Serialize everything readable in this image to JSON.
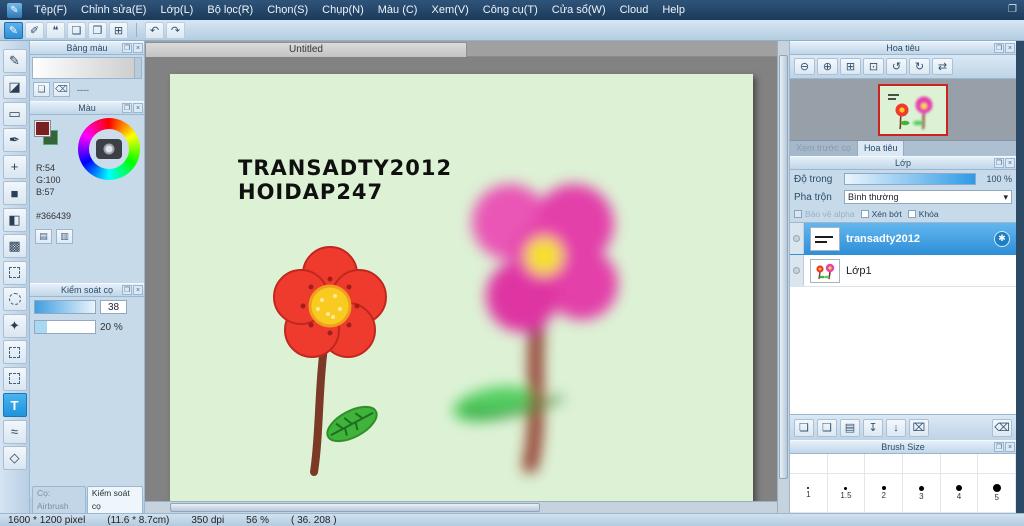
{
  "icons": {
    "app": "✎",
    "window": "❐",
    "dock": "❐",
    "close": "×",
    "undo": "↶",
    "redo": "↷",
    "zoom_out": "⊖",
    "zoom_in": "⊕",
    "fit_window": "⊞",
    "zoom_actual": "⊡",
    "rotate_ccw": "↺",
    "rotate_cw": "↻",
    "flip": "⇄",
    "new_layer": "❏",
    "new_linework_layer": "❑",
    "new_folder": "▤",
    "transfer_down": "↧",
    "merge_down": "↓",
    "clear_layer": "⌧",
    "delete_layer": "⌫",
    "gear": "✱",
    "palette_new": "❏",
    "palette_delete": "⌫",
    "swatch_grid1": "▤",
    "swatch_grid2": "▥",
    "dropdown_arrow": "▾"
  },
  "menubar": {
    "items": [
      "Tệp(F)",
      "Chỉnh sửa(E)",
      "Lớp(L)",
      "Bộ lọc(R)",
      "Chọn(S)",
      "Chụp(N)",
      "Màu (C)",
      "Xem(V)",
      "Công cụ(T)",
      "Cửa sổ(W)",
      "Cloud",
      "Help"
    ]
  },
  "toolbar": {
    "items": [
      {
        "name": "brush",
        "glyph": "✎"
      },
      {
        "name": "pin",
        "glyph": "✐"
      },
      {
        "name": "note",
        "glyph": "❝"
      },
      {
        "name": "doc1",
        "glyph": "❏"
      },
      {
        "name": "doc2",
        "glyph": "❐"
      },
      {
        "name": "grid",
        "glyph": "⊞"
      }
    ]
  },
  "tools": [
    {
      "name": "pencil",
      "glyph": "✎"
    },
    {
      "name": "eraser",
      "glyph": "◪"
    },
    {
      "name": "rect",
      "glyph": "▭"
    },
    {
      "name": "pen",
      "glyph": "✒"
    },
    {
      "name": "move",
      "glyph": "+"
    },
    {
      "name": "shape",
      "glyph": "■"
    },
    {
      "name": "bucket",
      "glyph": "◧"
    },
    {
      "name": "gradient",
      "glyph": "▩"
    },
    {
      "name": "select-rect",
      "glyph": ""
    },
    {
      "name": "lasso",
      "glyph": ""
    },
    {
      "name": "magic-wand",
      "glyph": "✦"
    },
    {
      "name": "select-pen",
      "glyph": ""
    },
    {
      "name": "select-eraser",
      "glyph": ""
    },
    {
      "name": "text",
      "glyph": "T"
    },
    {
      "name": "curve",
      "glyph": "≈"
    },
    {
      "name": "polygon",
      "glyph": "◇"
    }
  ],
  "palette_panel": {
    "title": "Bảng màu",
    "empty_label": "----"
  },
  "color_panel": {
    "title": "Màu",
    "r": "R:54",
    "g": "G:100",
    "b": "B:57",
    "hex": "#366439"
  },
  "brush_panel": {
    "title": "Kiểm soát cọ",
    "size": "38",
    "opacity": "20 %"
  },
  "canvas": {
    "tab": "Untitled",
    "text1": "TRANSADTY2012",
    "text2": "HOIDAP247"
  },
  "navigator": {
    "title": "Hoa tiêu",
    "tab_preview": "Xem trước cọ",
    "tab_nav": "Hoa tiêu"
  },
  "layers": {
    "title": "Lớp",
    "opacity_label": "Độ trong",
    "opacity_value": "100 %",
    "blend_label": "Pha trộn",
    "blend_value": "Bình thường",
    "cb_alpha": "Bảo vệ alpha",
    "cb_clip": "Xén bớt",
    "cb_lock": "Khóa",
    "rows": [
      {
        "name": "transadty2012",
        "selected": true
      },
      {
        "name": "Lớp1",
        "selected": false
      }
    ]
  },
  "brush_size": {
    "title": "Brush Size",
    "sizes": [
      "1",
      "1.5",
      "2",
      "3",
      "4",
      "5"
    ]
  },
  "bottom_tabs": {
    "tab1": "Cọ: Airbrush",
    "tab2": "Kiểm soát cọ"
  },
  "statusbar": {
    "size": "1600 * 1200 pixel",
    "cm": "(11.6 * 8.7cm)",
    "dpi": "350 dpi",
    "zoom": "56 %",
    "pos": "( 36. 208 )"
  },
  "colors": {
    "accent": "#2e9be6",
    "selected_layer": "#3f9fe0",
    "canvas_bg": "#ddf2d5",
    "fg_swatch": "#7a2020",
    "bg_swatch": "#366439",
    "menubar": "#1c3a5a"
  }
}
